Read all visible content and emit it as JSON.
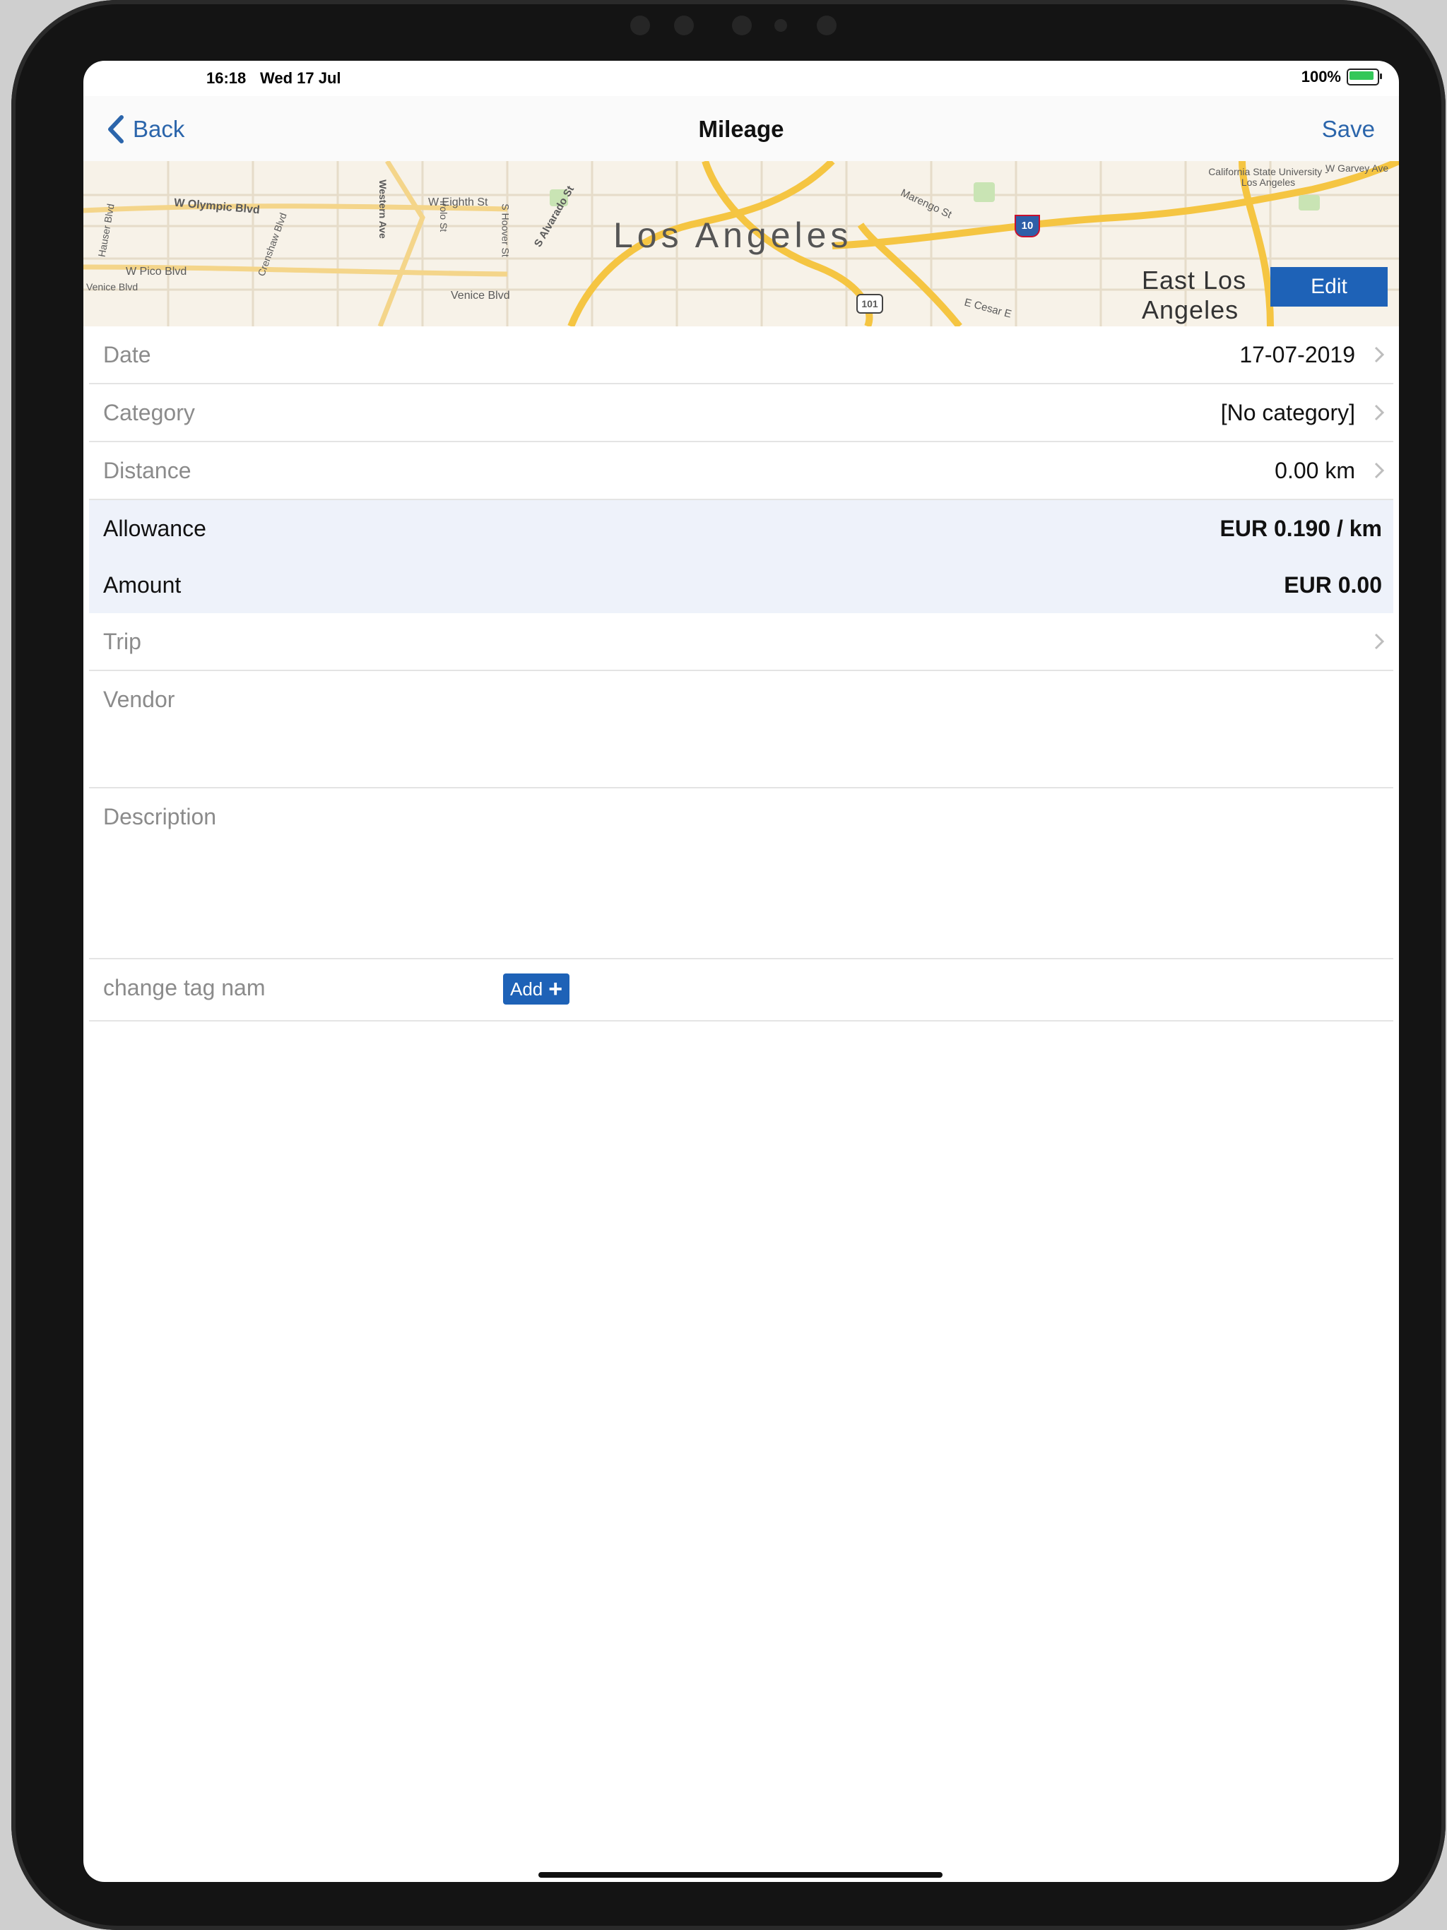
{
  "status_bar": {
    "time": "16:18",
    "date": "Wed 17 Jul",
    "battery_pct": "100%"
  },
  "nav": {
    "back_label": "Back",
    "title": "Mileage",
    "save_label": "Save"
  },
  "map": {
    "city_label": "Los Angeles",
    "district_label_1": "East Los",
    "district_label_2": "Angeles",
    "edit_label": "Edit",
    "street_labels": [
      "W Olympic Blvd",
      "W Eighth St",
      "W Pico Blvd",
      "Venice Blvd",
      "Marengo St",
      "S Alvarado St",
      "Western Ave",
      "Crenshaw Blvd",
      "E Cesar E",
      "W Garvey Ave",
      "Hauser Blvd",
      "Venice Blvd",
      "S Hoover St",
      "Irolo St",
      "California State University - Los Angeles",
      "101",
      "10"
    ]
  },
  "form": {
    "date_label": "Date",
    "date_value": "17-07-2019",
    "category_label": "Category",
    "category_value": "[No category]",
    "distance_label": "Distance",
    "distance_value": "0.00 km",
    "allowance_label": "Allowance",
    "allowance_value": "EUR 0.190 / km",
    "amount_label": "Amount",
    "amount_value": "EUR 0.00",
    "trip_label": "Trip",
    "vendor_label": "Vendor",
    "description_label": "Description",
    "tag_label": "change tag nam",
    "add_label": "Add"
  }
}
